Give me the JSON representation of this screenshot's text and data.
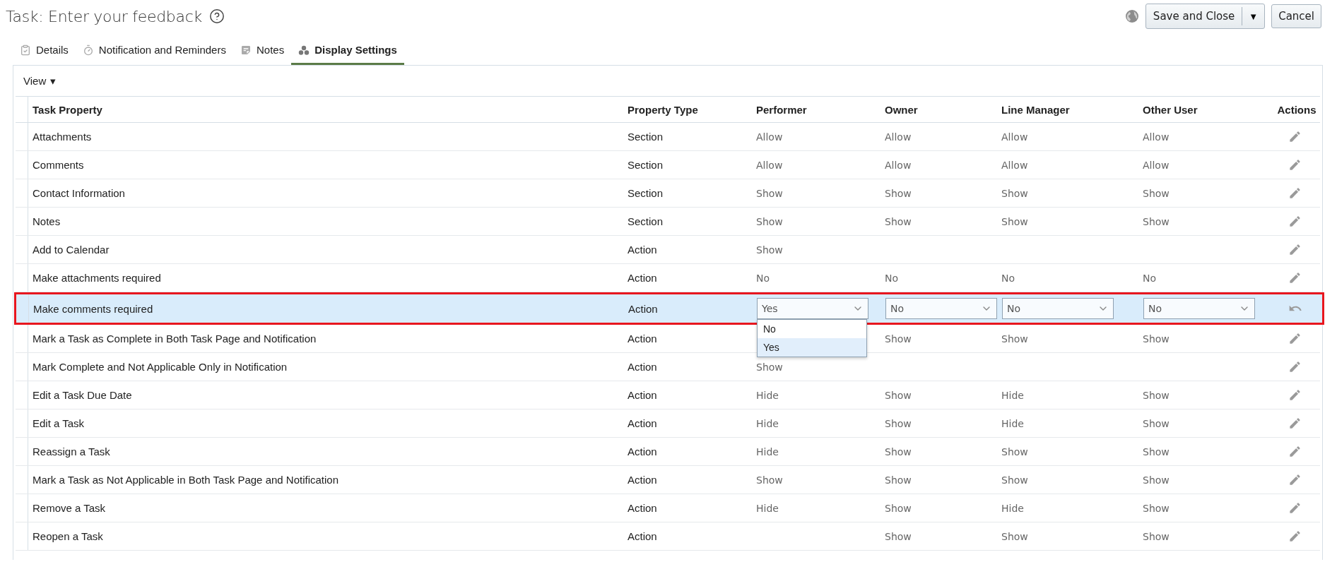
{
  "title": "Task: Enter your feedback",
  "header_buttons": {
    "save": "Save and Close",
    "save_menu": "▼",
    "cancel": "Cancel"
  },
  "tabs": [
    {
      "label": "Details",
      "selected": false
    },
    {
      "label": "Notification and Reminders",
      "selected": false
    },
    {
      "label": "Notes",
      "selected": false
    },
    {
      "label": "Display Settings",
      "selected": true
    }
  ],
  "view_menu": {
    "label": "View",
    "caret": "▾"
  },
  "table": {
    "columns": [
      "Task Property",
      "Property Type",
      "Performer",
      "Owner",
      "Line Manager",
      "Other User",
      "Actions"
    ],
    "rows": [
      {
        "kind": "view",
        "selected": false,
        "property": "Attachments",
        "type": "Section",
        "cells": [
          "Allow",
          "Allow",
          "Allow",
          "Allow"
        ]
      },
      {
        "kind": "view",
        "selected": false,
        "property": "Comments",
        "type": "Section",
        "cells": [
          "Allow",
          "Allow",
          "Allow",
          "Allow"
        ]
      },
      {
        "kind": "view",
        "selected": false,
        "property": "Contact Information",
        "type": "Section",
        "cells": [
          "Show",
          "Show",
          "Show",
          "Show"
        ]
      },
      {
        "kind": "view",
        "selected": false,
        "property": "Notes",
        "type": "Section",
        "cells": [
          "Show",
          "Show",
          "Show",
          "Show"
        ]
      },
      {
        "kind": "view",
        "selected": false,
        "property": "Add to Calendar",
        "type": "Action",
        "cells": [
          "Show",
          null,
          null,
          null
        ]
      },
      {
        "kind": "view",
        "selected": false,
        "property": "Make attachments required",
        "type": "Action",
        "cells": [
          "No",
          "No",
          "No",
          "No"
        ]
      },
      {
        "kind": "edit",
        "selected": true,
        "property": "Make comments required",
        "type": "Action",
        "selects": [
          {
            "value": "Yes",
            "open": true,
            "options": [
              {
                "label": "No",
                "selected": false
              },
              {
                "label": "Yes",
                "selected": true
              }
            ]
          },
          {
            "value": "No",
            "open": false
          },
          {
            "value": "No",
            "open": false
          },
          {
            "value": "No",
            "open": false
          }
        ]
      },
      {
        "kind": "view",
        "selected": false,
        "property": "Mark a Task as Complete in Both Task Page and Notification",
        "type": "Action",
        "cells": [
          null,
          "Show",
          "Show",
          "Show"
        ]
      },
      {
        "kind": "view",
        "selected": false,
        "property": "Mark Complete and Not Applicable Only in Notification",
        "type": "Action",
        "cells": [
          "Show",
          null,
          null,
          null
        ]
      },
      {
        "kind": "view",
        "selected": false,
        "property": "Edit a Task Due Date",
        "type": "Action",
        "cells": [
          "Hide",
          "Show",
          "Hide",
          "Show"
        ]
      },
      {
        "kind": "view",
        "selected": false,
        "property": "Edit a Task",
        "type": "Action",
        "cells": [
          "Hide",
          "Show",
          "Hide",
          "Show"
        ]
      },
      {
        "kind": "view",
        "selected": false,
        "property": "Reassign a Task",
        "type": "Action",
        "cells": [
          "Hide",
          "Show",
          "Show",
          "Show"
        ]
      },
      {
        "kind": "view",
        "selected": false,
        "property": "Mark a Task as Not Applicable in Both Task Page and Notification",
        "type": "Action",
        "cells": [
          "Show",
          "Show",
          "Show",
          "Show"
        ]
      },
      {
        "kind": "view",
        "selected": false,
        "property": "Remove a Task",
        "type": "Action",
        "cells": [
          "Hide",
          "Show",
          "Hide",
          "Show"
        ]
      },
      {
        "kind": "view",
        "selected": false,
        "property": "Reopen a Task",
        "type": "Action",
        "cells": [
          null,
          "Show",
          "Show",
          "Show"
        ]
      }
    ]
  }
}
